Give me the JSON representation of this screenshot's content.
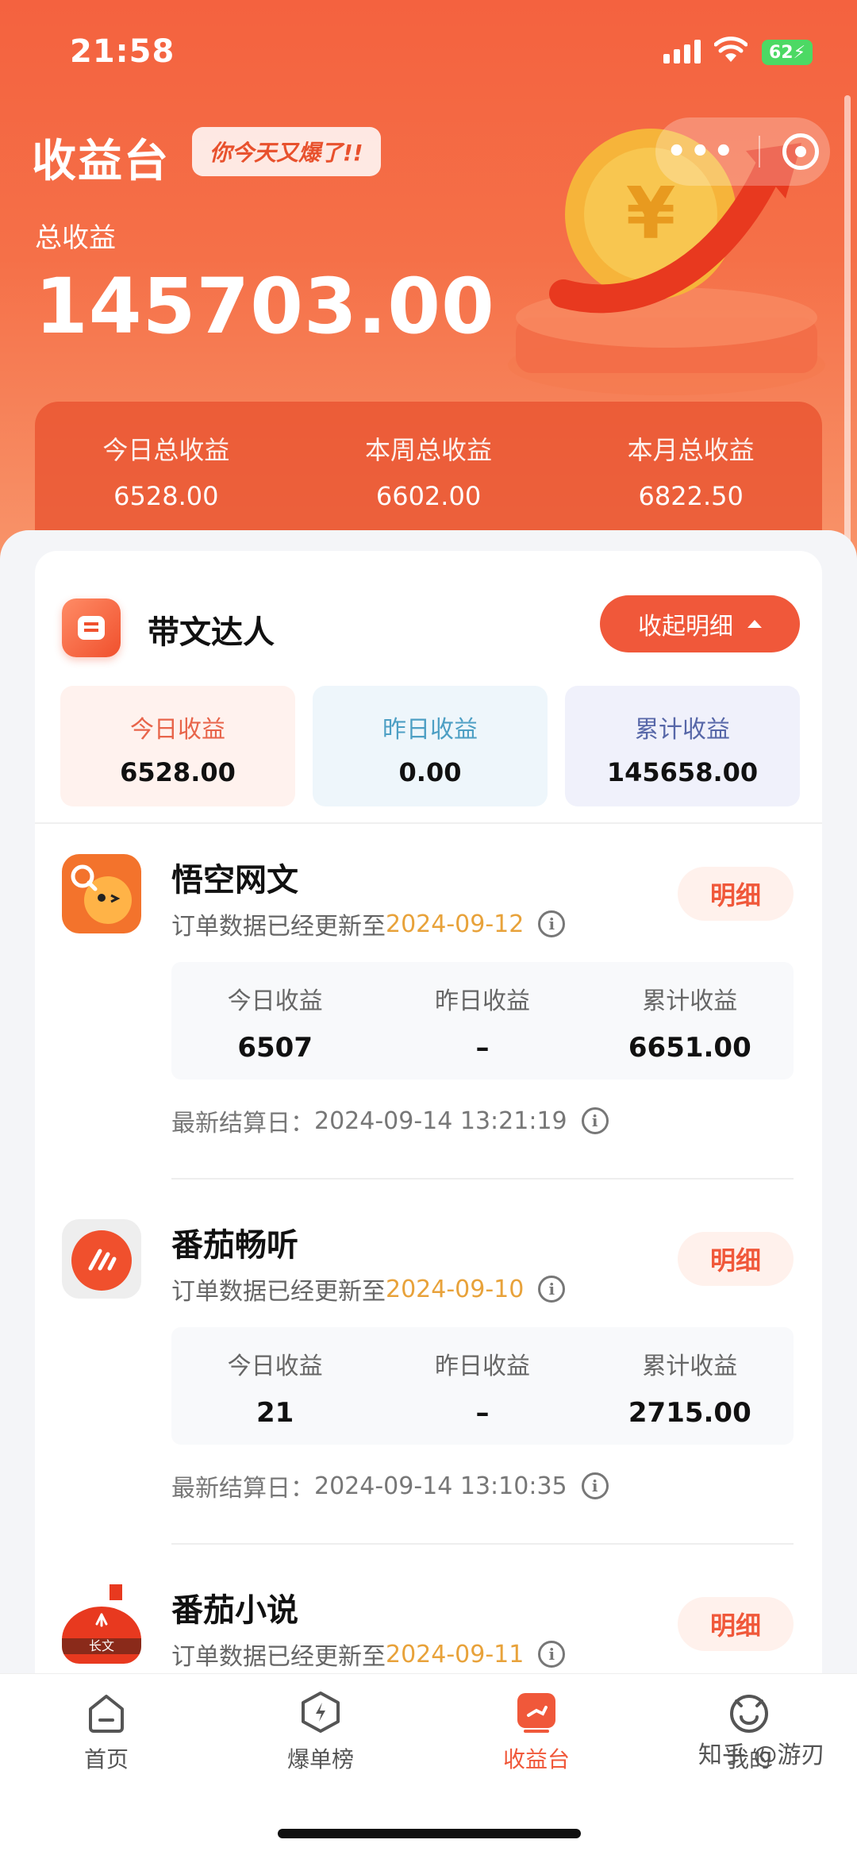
{
  "status_bar": {
    "time": "21:58",
    "battery": "62"
  },
  "header": {
    "title": "收益台",
    "slogan": "你今天又爆了!!",
    "total_label": "总收益",
    "total_amount": "145703.00",
    "periods": [
      {
        "label": "今日总收益",
        "value": "6528.00"
      },
      {
        "label": "本周总收益",
        "value": "6602.00"
      },
      {
        "label": "本月总收益",
        "value": "6822.50"
      }
    ]
  },
  "card": {
    "title": "带文达人",
    "collapse_label": "收起明细",
    "summary": [
      {
        "label": "今日收益",
        "value": "6528.00"
      },
      {
        "label": "昨日收益",
        "value": "0.00"
      },
      {
        "label": "累计收益",
        "value": "145658.00"
      }
    ],
    "apps": [
      {
        "name": "悟空网文",
        "update_prefix": "订单数据已经更新至",
        "update_date": "2024-09-12",
        "detail_label": "明细",
        "stats": [
          {
            "label": "今日收益",
            "value": "6507"
          },
          {
            "label": "昨日收益",
            "value": "–"
          },
          {
            "label": "累计收益",
            "value": "6651.00"
          }
        ],
        "settle_label": "最新结算日：",
        "settle_time": "2024-09-14 13:21:19"
      },
      {
        "name": "番茄畅听",
        "update_prefix": "订单数据已经更新至",
        "update_date": "2024-09-10",
        "detail_label": "明细",
        "stats": [
          {
            "label": "今日收益",
            "value": "21"
          },
          {
            "label": "昨日收益",
            "value": "–"
          },
          {
            "label": "累计收益",
            "value": "2715.00"
          }
        ],
        "settle_label": "最新结算日：",
        "settle_time": "2024-09-14 13:10:35"
      },
      {
        "name": "番茄小说",
        "update_prefix": "订单数据已经更新至",
        "update_date": "2024-09-11",
        "detail_label": "明细",
        "icon_text": "长文"
      }
    ]
  },
  "tabs": [
    {
      "label": "首页",
      "icon": "home-icon"
    },
    {
      "label": "爆单榜",
      "icon": "lightning-icon"
    },
    {
      "label": "收益台",
      "icon": "earnings-icon",
      "active": true
    },
    {
      "label": "我的",
      "icon": "profile-icon"
    }
  ],
  "watermark": "知乎 @游刃",
  "colors": {
    "accent": "#f0583a",
    "date": "#e8a23a",
    "header": "#f4623f"
  }
}
